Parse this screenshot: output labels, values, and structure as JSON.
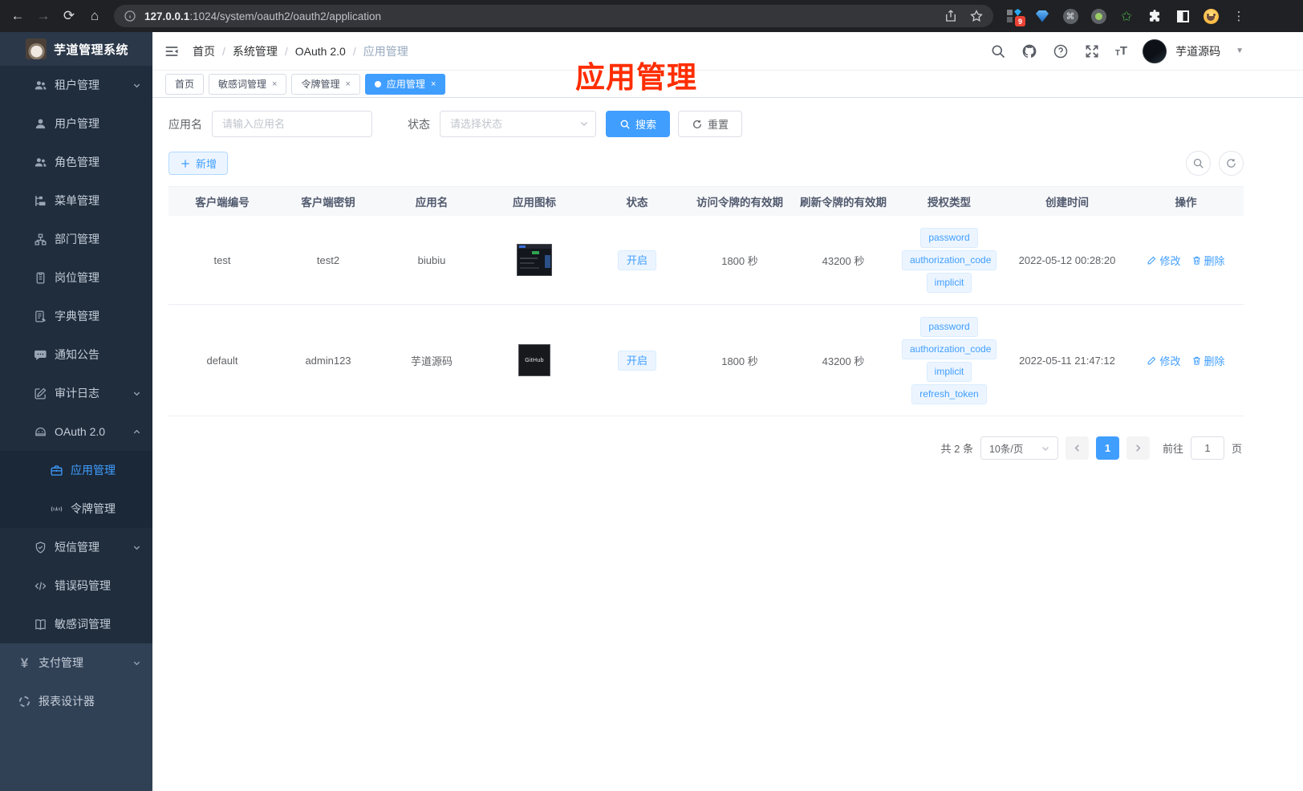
{
  "browser": {
    "url_host": "127.0.0.1",
    "url_rest": ":1024/system/oauth2/oauth2/application",
    "extension_badge": "9"
  },
  "sidebar": {
    "title": "芋道管理系统",
    "items": [
      {
        "label": "租户管理",
        "icon": "tenant-users-icon",
        "level": "sub",
        "chevron": "down"
      },
      {
        "label": "用户管理",
        "icon": "user-icon",
        "level": "sub"
      },
      {
        "label": "角色管理",
        "icon": "role-users-icon",
        "level": "sub"
      },
      {
        "label": "菜单管理",
        "icon": "menu-tree-icon",
        "level": "sub"
      },
      {
        "label": "部门管理",
        "icon": "org-chart-icon",
        "level": "sub"
      },
      {
        "label": "岗位管理",
        "icon": "post-badge-icon",
        "level": "sub"
      },
      {
        "label": "字典管理",
        "icon": "dictionary-icon",
        "level": "sub"
      },
      {
        "label": "通知公告",
        "icon": "announcement-icon",
        "level": "sub"
      },
      {
        "label": "审计日志",
        "icon": "audit-log-icon",
        "level": "sub",
        "chevron": "down"
      },
      {
        "label": "OAuth 2.0",
        "icon": "robot-icon",
        "level": "sub",
        "chevron": "up"
      },
      {
        "label": "应用管理",
        "icon": "briefcase-icon",
        "level": "nested",
        "active": true
      },
      {
        "label": "令牌管理",
        "icon": "token-signal-icon",
        "level": "nested"
      },
      {
        "label": "短信管理",
        "icon": "shield-icon",
        "level": "sub",
        "chevron": "down"
      },
      {
        "label": "错误码管理",
        "icon": "code-icon",
        "level": "sub"
      },
      {
        "label": "敏感词管理",
        "icon": "open-book-icon",
        "level": "sub"
      },
      {
        "label": "支付管理",
        "icon": "yen-icon",
        "level": "top",
        "chevron": "down"
      },
      {
        "label": "报表设计器",
        "icon": "report-designer-icon",
        "level": "top"
      }
    ]
  },
  "navbar": {
    "breadcrumb": [
      "首页",
      "系统管理",
      "OAuth 2.0",
      "应用管理"
    ],
    "username": "芋道源码"
  },
  "tabs": [
    {
      "label": "首页",
      "closable": false,
      "active": false
    },
    {
      "label": "敏感词管理",
      "closable": true,
      "active": false
    },
    {
      "label": "令牌管理",
      "closable": true,
      "active": false
    },
    {
      "label": "应用管理",
      "closable": true,
      "active": true
    }
  ],
  "annotation": {
    "text": "应用管理",
    "color": "#ff2d00"
  },
  "filter": {
    "name_label": "应用名",
    "name_placeholder": "请输入应用名",
    "status_label": "状态",
    "status_placeholder": "请选择状态",
    "search_label": "搜索",
    "reset_label": "重置"
  },
  "toolbar": {
    "add_label": "新增"
  },
  "table": {
    "headers": [
      "客户端编号",
      "客户端密钥",
      "应用名",
      "应用图标",
      "状态",
      "访问令牌的有效期",
      "刷新令牌的有效期",
      "授权类型",
      "创建时间",
      "操作"
    ],
    "rows": [
      {
        "client_id": "test",
        "client_secret": "test2",
        "app_name": "biubiu",
        "icon_type": "dashboard-screenshot",
        "status": "开启",
        "access_token_ttl": "1800 秒",
        "refresh_token_ttl": "43200 秒",
        "grant_types": [
          "password",
          "authorization_code",
          "implicit"
        ],
        "created_at": "2022-05-12 00:28:20"
      },
      {
        "client_id": "default",
        "client_secret": "admin123",
        "app_name": "芋道源码",
        "icon_type": "github-logo",
        "icon_text": "GitHub",
        "status": "开启",
        "access_token_ttl": "1800 秒",
        "refresh_token_ttl": "43200 秒",
        "grant_types": [
          "password",
          "authorization_code",
          "implicit",
          "refresh_token"
        ],
        "created_at": "2022-05-11 21:47:12"
      }
    ],
    "actions": {
      "edit": "修改",
      "delete": "删除"
    }
  },
  "pagination": {
    "total": "共 2 条",
    "page_size": "10条/页",
    "current": "1",
    "goto_label": "前往",
    "goto_value": "1",
    "page_unit": "页"
  },
  "colors": {
    "accent": "#409eff",
    "sidebar_bg": "#304156",
    "sidebar_sub_bg": "#1f2d3d",
    "annotation_red": "#ff2d00",
    "tag_bg": "#ecf5ff"
  }
}
